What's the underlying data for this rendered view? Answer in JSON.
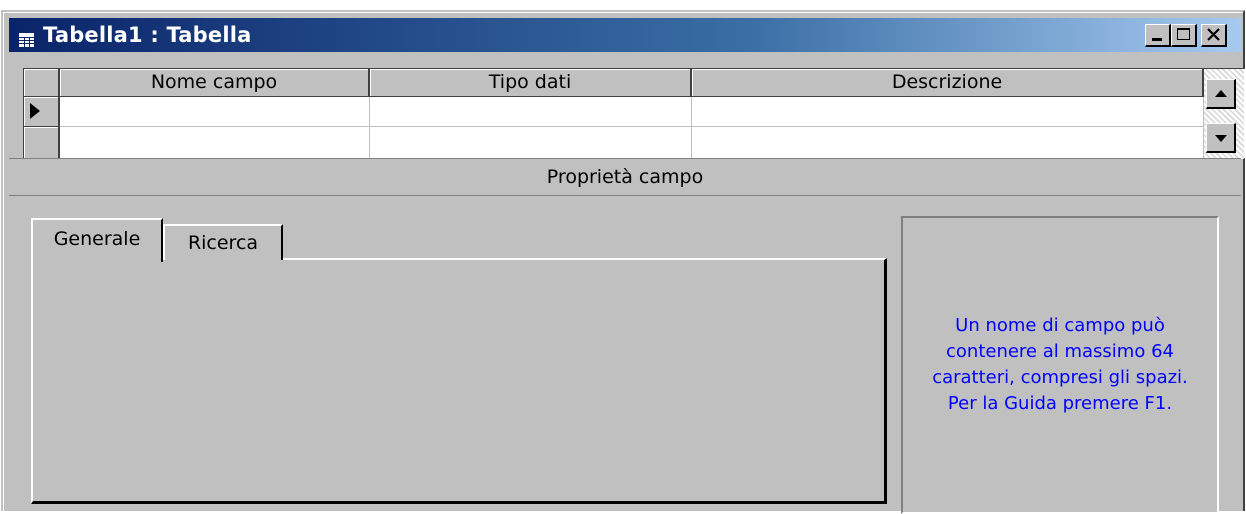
{
  "window": {
    "title": "Tabella1 : Tabella",
    "title_icon": "table-icon",
    "controls": {
      "minimize_icon": "minimize-icon",
      "maximize_icon": "maximize-icon",
      "close_icon": "close-icon"
    }
  },
  "grid": {
    "columns": [
      {
        "label": "Nome campo"
      },
      {
        "label": "Tipo dati"
      },
      {
        "label": "Descrizione"
      }
    ],
    "rows": [
      {
        "nome": "",
        "tipo": "",
        "descrizione": "",
        "current": true
      },
      {
        "nome": "",
        "tipo": "",
        "descrizione": "",
        "current": false
      }
    ],
    "row_selector_icon": "row-pointer-icon",
    "scroll_up_icon": "arrow-up-icon",
    "scroll_down_icon": "arrow-down-icon"
  },
  "properties": {
    "header": "Proprietà campo",
    "tabs": [
      {
        "label": "Generale",
        "active": true
      },
      {
        "label": "Ricerca",
        "active": false
      }
    ],
    "help_lines": [
      "Un nome di campo può",
      "contenere al massimo 64",
      "caratteri, compresi gli spazi.",
      "Per la Guida premere F1."
    ]
  },
  "colors": {
    "title_start": "#0a246a",
    "title_end": "#a6caf0",
    "face": "#c0c0c0",
    "help_text": "#0000ff"
  }
}
